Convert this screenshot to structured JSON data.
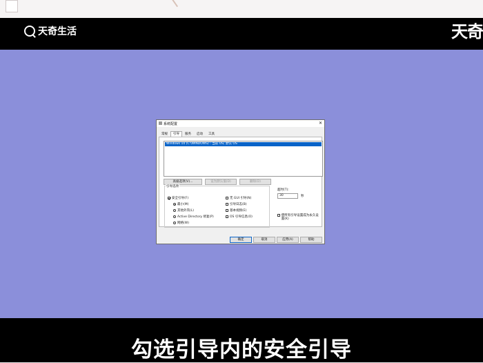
{
  "brand": {
    "name": "天奇生活",
    "right_mark": "天奇"
  },
  "caption": "勾选引导内的安全引导",
  "dialog": {
    "title": "系统配置",
    "tabs": [
      "常规",
      "引导",
      "服务",
      "启动",
      "工具"
    ],
    "active_tab": "引导",
    "boot_entry": "Windows 10 (C:\\WINDOWS) : 当前 OS; 默认 OS",
    "buttons": {
      "advanced": "高级选项(V)...",
      "set_default": "设为默认值(D)",
      "delete": "删除(D)"
    },
    "boot_options_title": "引导选项",
    "safe_boot": "安全引导(F)",
    "radios": [
      "最小(M)",
      "其他外壳(L)",
      "Active Directory 修复(P)",
      "网络(W)"
    ],
    "right_checks": [
      "无 GUI 引导(N)",
      "引导日志(B)",
      "基本视频(E)",
      "OS 引导信息(O)"
    ],
    "timeout_label": "超时(T):",
    "timeout_value": "30",
    "seconds": "秒",
    "permanent": "使所有引导设置成为永久设置(K)",
    "footer": {
      "ok": "确定",
      "cancel": "取消",
      "apply": "应用(A)",
      "help": "帮助"
    }
  }
}
